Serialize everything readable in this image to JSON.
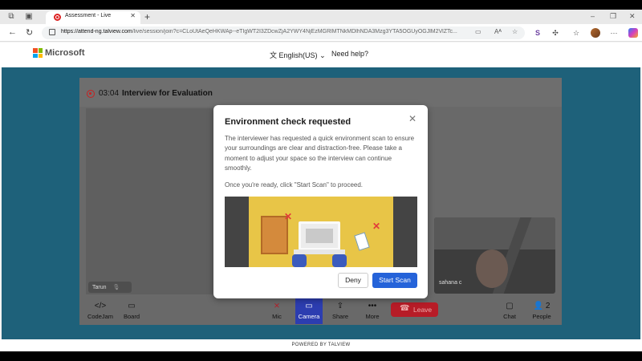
{
  "browser": {
    "tab_title": "Assessment - Live",
    "new_tab": "+",
    "url_domain": "https://attend-ng.talview.com",
    "url_rest": "/live/session/join?c=CLoUtAeQeHKWAp--eTIgWT2I3ZDcwZjA2YWY4NjEzMGRlMTNkMDlhNDA3Mzg3YTA5OGUyOGJlM2VlZTc...",
    "reader_label": "Aᴬ"
  },
  "site": {
    "brand": "Microsoft",
    "language": "English(US)",
    "help": "Need help?",
    "brand_colors": [
      "#f25022",
      "#7fba00",
      "#00a4ef",
      "#ffb900"
    ]
  },
  "session": {
    "timer": "03:04",
    "title": "Interview for Evaluation",
    "participant_main": "Tarun",
    "participant_self": "sahana c"
  },
  "toolbar": {
    "codejam": "CodeJam",
    "board": "Board",
    "mic": "Mic",
    "camera": "Camera",
    "share": "Share",
    "more": "More",
    "leave": "Leave",
    "chat": "Chat",
    "people": "People",
    "people_count": "2"
  },
  "footer": {
    "powered": "POWERED BY TALVIEW"
  },
  "modal": {
    "title": "Environment check requested",
    "body": "The interviewer has requested a quick environment scan to ensure your surroundings are clear and distraction-free. Please take a moment to adjust your space so the interview can continue smoothly.",
    "prompt": "Once you're ready, click \"Start Scan\" to proceed.",
    "deny": "Deny",
    "start": "Start Scan",
    "accent": "#2563d9"
  },
  "colors": {
    "page_bg": "#1e617a",
    "leave_bg": "#b71c27",
    "camera_active": "#2c3db0"
  }
}
